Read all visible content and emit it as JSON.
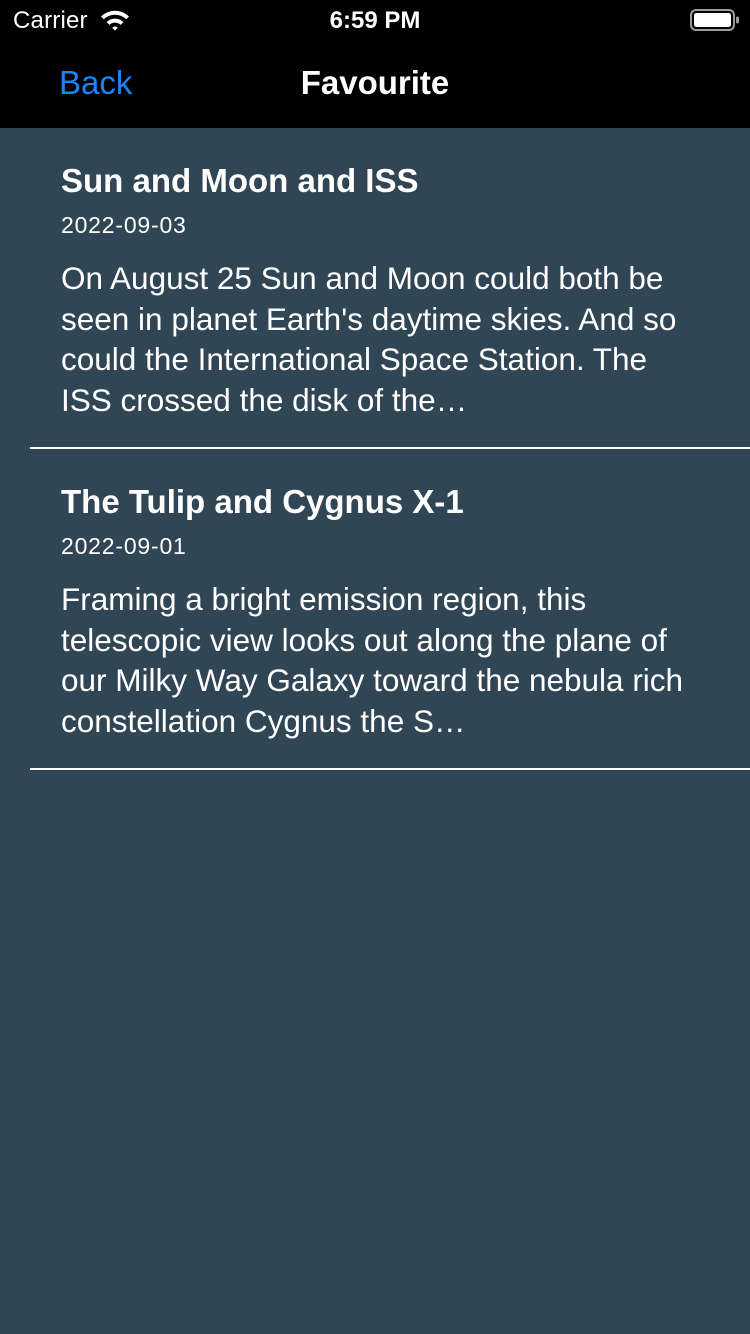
{
  "status_bar": {
    "carrier": "Carrier",
    "time": "6:59 PM",
    "wifi_icon": "wifi-icon",
    "battery_icon": "battery-icon"
  },
  "nav": {
    "back_label": "Back",
    "title": "Favourite",
    "accent_color": "#1a84ff"
  },
  "items": [
    {
      "title": "Sun and Moon and ISS",
      "date": "2022-09-03",
      "description": "On August 25 Sun and Moon could both be seen in planet Earth's daytime skies. And so could the International Space Station. The ISS crossed the disk of the…"
    },
    {
      "title": "The Tulip and Cygnus X-1",
      "date": "2022-09-01",
      "description": "Framing a bright emission region, this telescopic view looks out along the plane of our Milky Way Galaxy toward the nebula rich constellation Cygnus the S…"
    }
  ],
  "colors": {
    "background": "#314655",
    "bar": "#000000"
  }
}
